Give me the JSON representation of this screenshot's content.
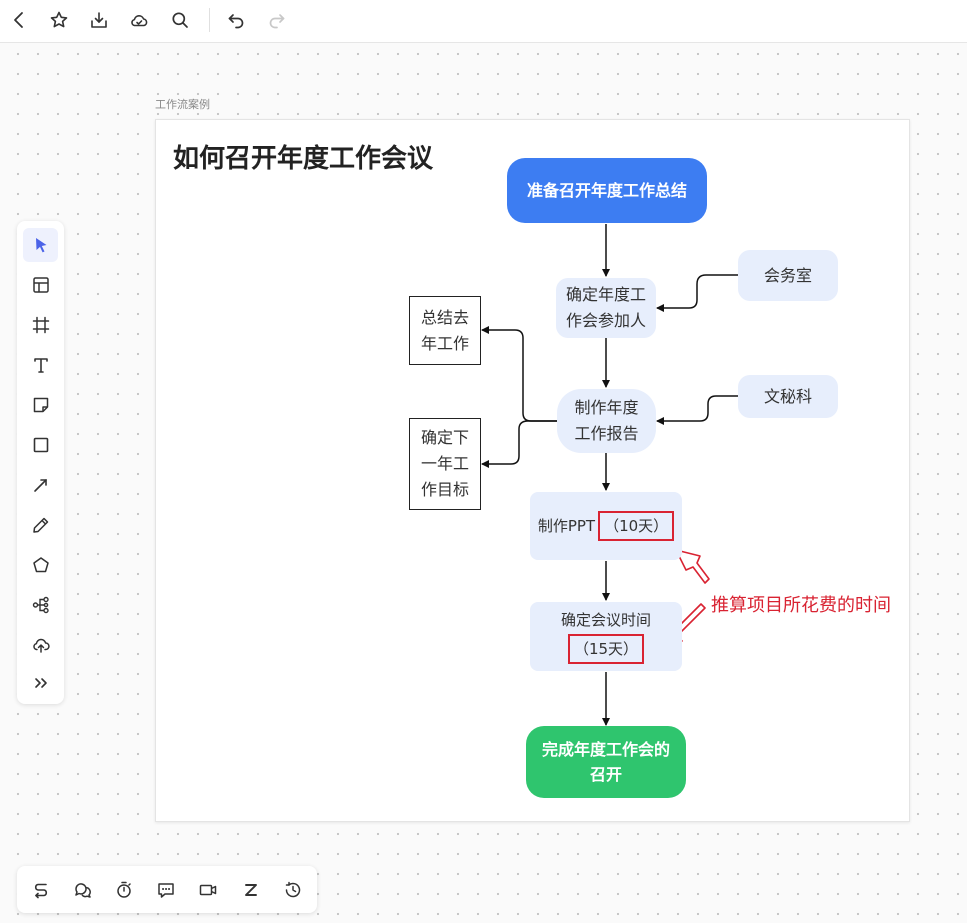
{
  "top_toolbar": {
    "icons": [
      "back-icon",
      "star-icon",
      "download-icon",
      "cloud-icon",
      "search-icon",
      "undo-icon",
      "redo-icon"
    ]
  },
  "frame": {
    "label": "工作流案例"
  },
  "diagram": {
    "title": "如何召开年度工作会议",
    "nodes": {
      "start": "准备召开年度工作总结",
      "participants": "确定年度工\n作会参加人",
      "meeting_office": "会务室",
      "report": "制作年度\n工作报告",
      "secretary": "文秘科",
      "summary_last_year": "总结去\n年工作",
      "next_year_goals": "确定下\n一年工\n作目标",
      "ppt_prefix": "制作PPT",
      "ppt_duration": "（10天）",
      "meeting_time_prefix": "确定会议时间",
      "meeting_time_duration": "（15天）",
      "end": "完成年度工作会的\n召开"
    },
    "annotation": "推算项目所花费的时间"
  },
  "colors": {
    "start_node": "#3d7df2",
    "end_node": "#2fc56e",
    "process_node": "#e7eefc",
    "highlight": "#d92332",
    "active_tool": "#4b63e8"
  },
  "left_toolbar": {
    "tools": [
      "select-icon",
      "template-icon",
      "frame-icon",
      "text-icon",
      "sticky-note-icon",
      "rectangle-icon",
      "line-icon",
      "pen-icon",
      "polygon-icon",
      "mindmap-icon",
      "upload-icon",
      "more-icon"
    ],
    "active": "select-icon"
  },
  "bottom_toolbar": {
    "icons": [
      "flow-icon",
      "comments-icon",
      "timer-icon",
      "chat-icon",
      "video-icon",
      "sleep-icon",
      "history-icon"
    ]
  }
}
